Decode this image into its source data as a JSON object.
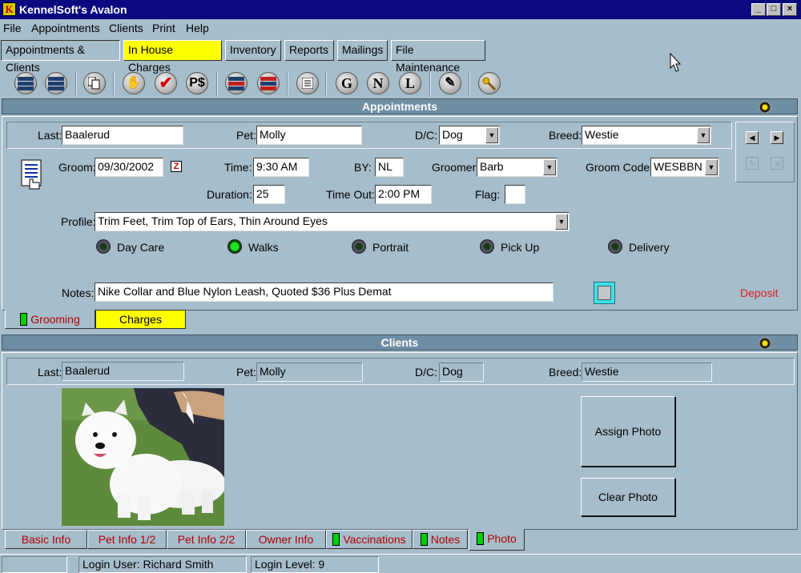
{
  "window": {
    "title": "KennelSoft's Avalon",
    "app_icon": "K"
  },
  "menu": {
    "file": "File",
    "appointments": "Appointments",
    "clients": "Clients",
    "print": "Print",
    "help": "Help"
  },
  "main_tabs": {
    "appointments_clients": "Appointments & Clients",
    "in_house_charges": "In House Charges",
    "inventory": "Inventory",
    "reports": "Reports",
    "mailings": "Mailings",
    "file_maintenance": "File Maintenance"
  },
  "toolbar": {
    "g": "G",
    "n": "N",
    "l": "L",
    "ps": "P$"
  },
  "appointments": {
    "header": "Appointments",
    "last_label": "Last:",
    "last": "Baalerud",
    "pet_label": "Pet:",
    "pet": "Molly",
    "dc_label": "D/C:",
    "dc": "Dog",
    "breed_label": "Breed:",
    "breed": "Westie",
    "groom_label": "Groom:",
    "groom_date": "09/30/2002",
    "time_label": "Time:",
    "time": "9:30 AM",
    "by_label": "BY:",
    "by": "NL",
    "groomer_label": "Groomer:",
    "groomer": "Barb",
    "groom_code_label": "Groom Code:",
    "groom_code": "WESBBN",
    "duration_label": "Duration:",
    "duration": "25",
    "time_out_label": "Time Out:",
    "time_out": "2:00 PM",
    "flag_label": "Flag:",
    "flag": "",
    "profile_label": "Profile:",
    "profile": "Trim Feet, Trim Top of Ears, Thin Around Eyes",
    "options": {
      "day_care": "Day Care",
      "walks": "Walks",
      "portrait": "Portrait",
      "pick_up": "Pick Up",
      "delivery": "Delivery"
    },
    "notes_label": "Notes:",
    "notes": "Nike Collar and Blue Nylon Leash,  Quoted $36 Plus Demat",
    "deposit": "Deposit"
  },
  "appt_tabs": {
    "grooming": "Grooming",
    "charges": "Charges"
  },
  "clients": {
    "header": "Clients",
    "last_label": "Last:",
    "last": "Baalerud",
    "pet_label": "Pet:",
    "pet": "Molly",
    "dc_label": "D/C:",
    "dc": "Dog",
    "breed_label": "Breed:",
    "breed": "Westie",
    "assign_photo": "Assign Photo",
    "clear_photo": "Clear Photo"
  },
  "client_tabs": {
    "basic_info": "Basic Info",
    "pet_info_1": "Pet Info 1/2",
    "pet_info_2": "Pet Info 2/2",
    "owner_info": "Owner Info",
    "vaccinations": "Vaccinations",
    "notes": "Notes",
    "photo": "Photo"
  },
  "status": {
    "login_user": "Login User: Richard Smith",
    "login_level": "Login Level: 9"
  },
  "colors": {
    "background": "#a6bdcb",
    "titlebar": "#0a0a80",
    "section_header": "#6f8ea4",
    "highlight": "#ffff00",
    "deposit": "#e02020",
    "indicator": "#00d000"
  }
}
